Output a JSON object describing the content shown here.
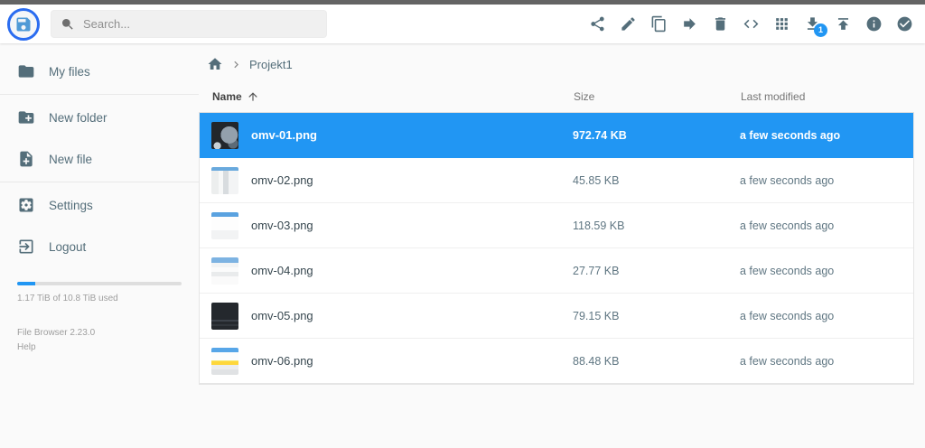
{
  "header": {
    "search_placeholder": "Search...",
    "download_badge": "1",
    "action_names": [
      "share",
      "rename",
      "copy",
      "move",
      "delete",
      "raw-view",
      "switch-view",
      "download",
      "upload",
      "info",
      "select"
    ]
  },
  "sidebar": {
    "items": [
      {
        "label": "My files",
        "icon": "folder-icon"
      },
      {
        "label": "New folder",
        "icon": "new-folder-icon"
      },
      {
        "label": "New file",
        "icon": "new-file-icon"
      },
      {
        "label": "Settings",
        "icon": "settings-icon"
      },
      {
        "label": "Logout",
        "icon": "logout-icon"
      }
    ],
    "usage": {
      "text": "1.17 TiB of 10.8 TiB used",
      "percent": 11
    },
    "version": "File Browser 2.23.0",
    "help_label": "Help"
  },
  "breadcrumb": {
    "path": "Projekt1"
  },
  "listing": {
    "columns": {
      "name": "Name",
      "size": "Size",
      "modified": "Last modified"
    },
    "sort": {
      "column": "name",
      "direction": "asc"
    },
    "files": [
      {
        "name": "omv-01.png",
        "size": "972.74 KB",
        "modified": "a few seconds ago",
        "selected": true
      },
      {
        "name": "omv-02.png",
        "size": "45.85 KB",
        "modified": "a few seconds ago",
        "selected": false
      },
      {
        "name": "omv-03.png",
        "size": "118.59 KB",
        "modified": "a few seconds ago",
        "selected": false
      },
      {
        "name": "omv-04.png",
        "size": "27.77 KB",
        "modified": "a few seconds ago",
        "selected": false
      },
      {
        "name": "omv-05.png",
        "size": "79.15 KB",
        "modified": "a few seconds ago",
        "selected": false
      },
      {
        "name": "omv-06.png",
        "size": "88.48 KB",
        "modified": "a few seconds ago",
        "selected": false
      }
    ]
  },
  "colors": {
    "accent": "#2196f3",
    "selected_row": "#2196f3",
    "toolbar_icon": "#546e7a",
    "logo_ring": "#2a6cf0"
  }
}
